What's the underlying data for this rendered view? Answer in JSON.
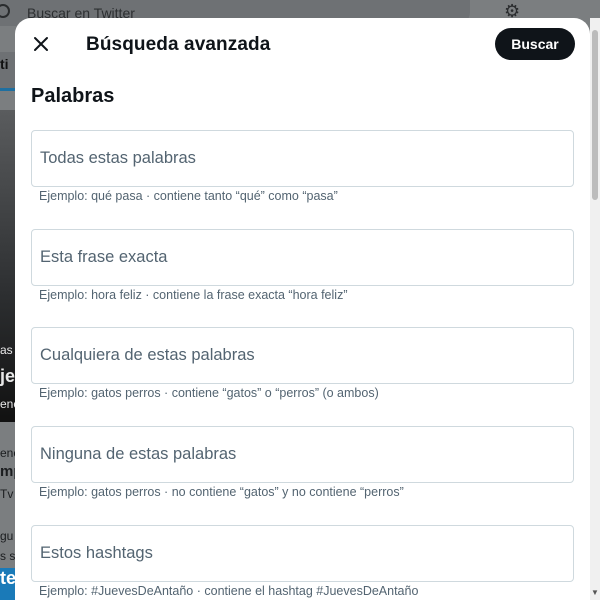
{
  "background": {
    "search_placeholder": "Buscar en Twitter",
    "tab_fragment": "ti",
    "fragments": [
      "as",
      "je",
      "enc",
      "enc",
      "mp",
      "Tv",
      "gu",
      "s s"
    ],
    "blue_fragment": "te"
  },
  "modal": {
    "title": "Búsqueda avanzada",
    "search_button": "Buscar",
    "section_title": "Palabras",
    "fields": [
      {
        "placeholder": "Todas estas palabras",
        "value": "",
        "hint": "Ejemplo: qué pasa · contiene tanto “qué” como “pasa”"
      },
      {
        "placeholder": "Esta frase exacta",
        "value": "",
        "hint": "Ejemplo: hora feliz · contiene la frase exacta “hora feliz”"
      },
      {
        "placeholder": "Cualquiera de estas palabras",
        "value": "",
        "hint": "Ejemplo: gatos perros · contiene “gatos” o “perros” (o ambos)"
      },
      {
        "placeholder": "Ninguna de estas palabras",
        "value": "",
        "hint": "Ejemplo: gatos perros · no contiene “gatos” y no contiene “perros”"
      },
      {
        "placeholder": "Estos hashtags",
        "value": "",
        "hint": "Ejemplo: #JuevesDeAntaño · contiene el hashtag #JuevesDeAntaño"
      }
    ]
  },
  "icons": {
    "close": "close-icon",
    "search": "search-icon",
    "settings": "gear-icon"
  },
  "colors": {
    "accent": "#0f1419",
    "border": "#cfd9de",
    "hint": "#536471",
    "overlay": "#7b7e80"
  }
}
